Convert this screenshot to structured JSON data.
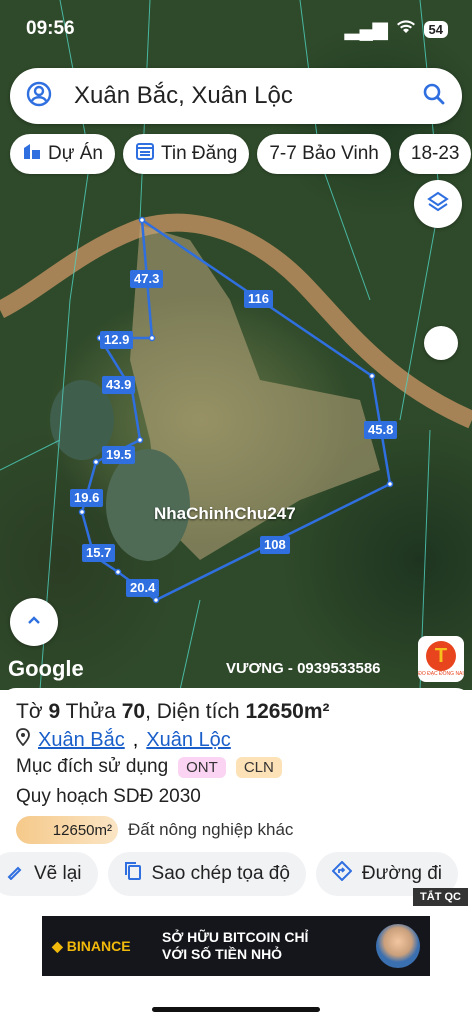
{
  "status_bar": {
    "time": "09:56",
    "battery": "54"
  },
  "search": {
    "query": "Xuân Bắc, Xuân Lộc"
  },
  "chips": [
    {
      "label": "Dự Án",
      "icon": "building-icon"
    },
    {
      "label": "Tin Đăng",
      "icon": "calendar-list-icon"
    },
    {
      "label": "7-7 Bảo Vinh"
    },
    {
      "label": "18-23"
    }
  ],
  "map": {
    "edge_labels": [
      "47.3",
      "116",
      "12.9",
      "43.9",
      "45.8",
      "19.5",
      "19.6",
      "108",
      "15.7",
      "20.4"
    ],
    "watermark": "NhaChinhChu247",
    "google": "Google",
    "owner_contact": "VƯƠNG - 0939533586",
    "logo_letter": "T",
    "logo_caption": "ĐO ĐẠC ĐỒNG NAI",
    "boundary_color": "#2f6fe0"
  },
  "parcel": {
    "sheet_label": "Tờ",
    "sheet_no": "9",
    "parcel_label": "Thửa",
    "parcel_no": "70",
    "area_label": "Diện tích",
    "area_value": "12650m²",
    "commune": "Xuân Bắc",
    "district": "Xuân Lộc",
    "purpose_label": "Mục đích sử dụng",
    "purposes": [
      "ONT",
      "CLN"
    ],
    "plan_label": "Quy hoạch SDĐ 2030",
    "plan_area": "12650m²",
    "plan_type": "Đất nông nghiệp khác"
  },
  "actions": [
    {
      "label": "Vẽ lại",
      "icon": "redraw-icon"
    },
    {
      "label": "Sao chép tọa độ",
      "icon": "copy-icon"
    },
    {
      "label": "Đường đi",
      "icon": "directions-icon"
    }
  ],
  "ad": {
    "close_label": "TẮT QC",
    "brand": "BINANCE",
    "line1": "SỞ HỮU BITCOIN CHỈ",
    "line2": "VỚI SỐ TIỀN NHỎ"
  }
}
